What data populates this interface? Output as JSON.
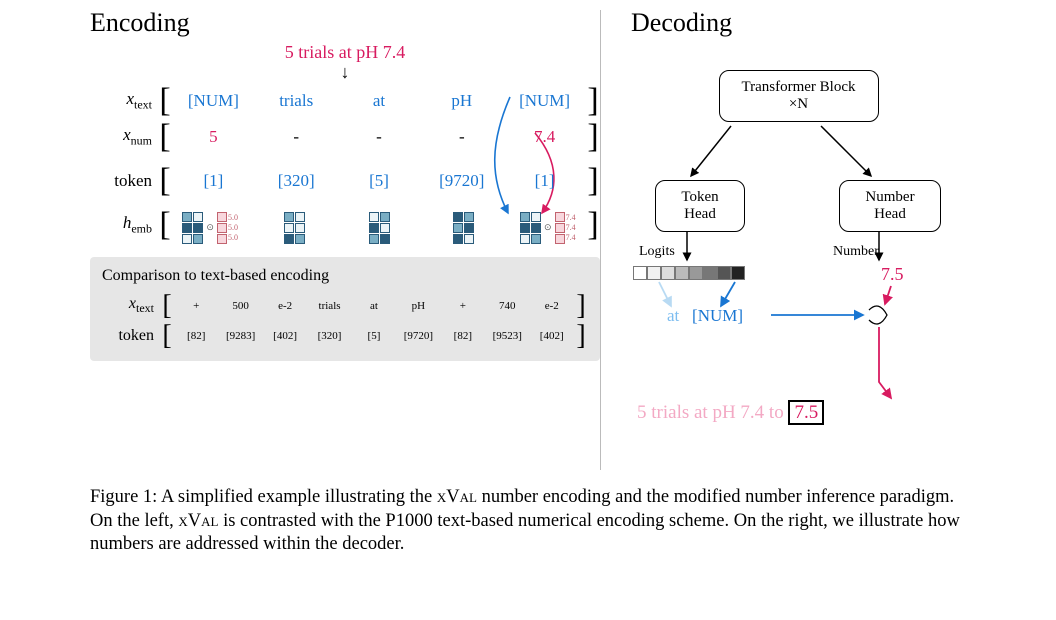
{
  "encoding": {
    "title": "Encoding",
    "input": "5 trials at pH 7.4",
    "x_text_label": "x",
    "x_text_sub": "text",
    "x_num_label": "x",
    "x_num_sub": "num",
    "token_label": "token",
    "hemb_label": "h",
    "hemb_sub": "emb",
    "x_text": [
      "[NUM]",
      "trials",
      "at",
      "pH",
      "[NUM]"
    ],
    "x_num": [
      "5",
      "-",
      "-",
      "-",
      "7.4"
    ],
    "tokens": [
      "[1]",
      "[320]",
      "[5]",
      "[9720]",
      "[1]"
    ],
    "hemb_tiny_left": "5.0",
    "hemb_tiny_right": "7.4"
  },
  "comparison": {
    "title": "Comparison to text-based encoding",
    "x_text_label": "x",
    "x_text_sub": "text",
    "token_label": "token",
    "x_text": [
      "+",
      "500",
      "e-2",
      "trials",
      "at",
      "pH",
      "+",
      "740",
      "e-2"
    ],
    "tokens": [
      "[82]",
      "[9283]",
      "[402]",
      "[320]",
      "[5]",
      "[9720]",
      "[82]",
      "[9523]",
      "[402]"
    ]
  },
  "decoding": {
    "title": "Decoding",
    "transformer": "Transformer Block ×N",
    "token_head": "Token Head",
    "number_head": "Number Head",
    "logits_label": "Logits",
    "number_label": "Number",
    "number_out": "7.5",
    "at": "at",
    "num_token": "[NUM]",
    "output_prefix": "5 trials at pH 7.4 to ",
    "output_box": "7.5"
  },
  "caption": {
    "label": "Figure 1:",
    "body1": " A simplified example illustrating the ",
    "xval1": "xVal",
    "body2": " number encoding and the modified number inference paradigm. On the left, ",
    "xval2": "xVal",
    "body3": " is contrasted with the P1000 text-based numerical encoding scheme. On the right, we illustrate how numbers are addressed within the decoder."
  }
}
